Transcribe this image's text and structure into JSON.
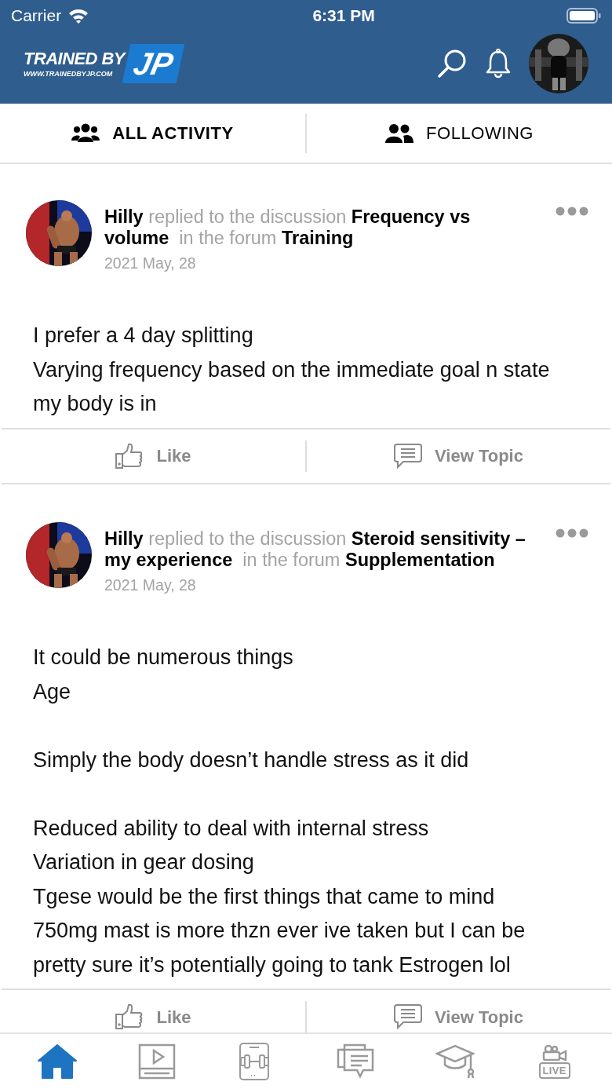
{
  "status_bar": {
    "carrier": "Carrier",
    "time": "6:31 PM"
  },
  "header": {
    "logo": {
      "brand": "TRAINED BY",
      "url": "WWW.TRAINEDBYJP.COM",
      "mark": "JP"
    }
  },
  "tabs": [
    {
      "label": "ALL ACTIVITY",
      "kind": "group",
      "selected": true
    },
    {
      "label": "FOLLOWING",
      "kind": "pair",
      "selected": false
    }
  ],
  "posts": [
    {
      "author": "Hilly",
      "action": "replied to the discussion",
      "topic": "Frequency vs volume",
      "connector": "in the forum",
      "forum": "Training",
      "date": "2021 May, 28",
      "paragraphs": [
        [
          "I prefer a 4 day splitting",
          "Varying frequency based on the immediate goal n state my body is in"
        ]
      ],
      "actions": [
        "Like",
        "View Topic"
      ]
    },
    {
      "author": "Hilly",
      "action": "replied to the discussion",
      "topic": "Steroid sensitivity – my experience",
      "connector": "in the forum",
      "forum": "Supplementation",
      "date": "2021 May, 28",
      "paragraphs": [
        [
          "It could be numerous things",
          "Age"
        ],
        [
          "Simply the body doesn’t handle stress as it did"
        ],
        [
          "Reduced ability to deal with internal stress",
          "Variation in gear dosing",
          "Tgese would be the first things that came to mind",
          "750mg mast is more thzn ever ive taken but I can be pretty sure it’s potentially going to tank Estrogen lol"
        ]
      ],
      "actions": [
        "Like",
        "View Topic"
      ]
    }
  ],
  "nav": [
    {
      "kind": "home",
      "selected": true
    },
    {
      "kind": "video",
      "selected": false
    },
    {
      "kind": "workout",
      "selected": false
    },
    {
      "kind": "forum",
      "selected": false
    },
    {
      "kind": "courses",
      "selected": false
    },
    {
      "kind": "live",
      "label": "LIVE",
      "selected": false
    }
  ]
}
